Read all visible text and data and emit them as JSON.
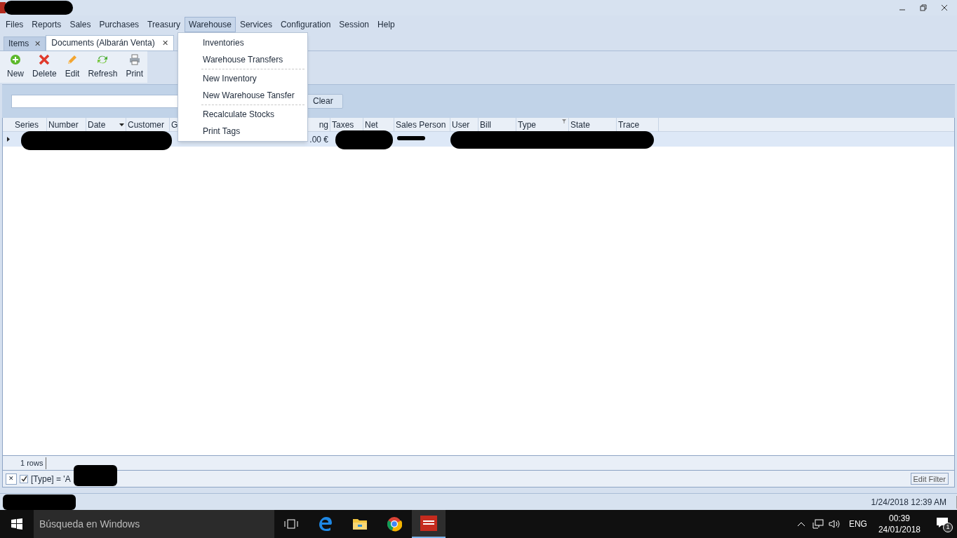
{
  "menu_bar": [
    {
      "label": "Files",
      "selected": false
    },
    {
      "label": "Reports",
      "selected": false
    },
    {
      "label": "Sales",
      "selected": false
    },
    {
      "label": "Purchases",
      "selected": false
    },
    {
      "label": "Treasury",
      "selected": false
    },
    {
      "label": "Warehouse",
      "selected": true
    },
    {
      "label": "Services",
      "selected": false
    },
    {
      "label": "Configuration",
      "selected": false
    },
    {
      "label": "Session",
      "selected": false
    },
    {
      "label": "Help",
      "selected": false
    }
  ],
  "dropdown_menu": [
    {
      "label": "Inventories",
      "separator_after": false
    },
    {
      "label": "Warehouse Transfers",
      "separator_after": true
    },
    {
      "label": "New Inventory",
      "separator_after": false
    },
    {
      "label": "New Warehouse Tansfer",
      "separator_after": true
    },
    {
      "label": "Recalculate Stocks",
      "separator_after": false
    },
    {
      "label": "Print Tags",
      "separator_after": false
    }
  ],
  "tabs": [
    {
      "label": "Items",
      "selected": false,
      "close": "✕"
    },
    {
      "label": "Documents (Albarán Venta)",
      "selected": true,
      "close": "✕"
    }
  ],
  "toolbar": [
    {
      "label": "New"
    },
    {
      "label": "Delete"
    },
    {
      "label": "Edit"
    },
    {
      "label": "Refresh"
    },
    {
      "label": "Print"
    }
  ],
  "search": {
    "button": "Clear"
  },
  "table": {
    "columns": [
      {
        "label": "Series"
      },
      {
        "label": "Number"
      },
      {
        "label": "Date",
        "sorted": true
      },
      {
        "label": "Customer"
      },
      {
        "label": "G"
      },
      {
        "label": "ng"
      },
      {
        "label": "Taxes"
      },
      {
        "label": "Net"
      },
      {
        "label": "Sales Person"
      },
      {
        "label": "User"
      },
      {
        "label": "Bill"
      },
      {
        "label": "Type",
        "filtered": true
      },
      {
        "label": "State"
      },
      {
        "label": "Trace"
      }
    ],
    "rows": [
      {
        "selected": true,
        "cells": [
          "",
          "",
          "",
          "",
          "",
          ".00 €",
          "",
          "",
          "",
          "",
          "",
          "",
          "",
          ""
        ]
      }
    ]
  },
  "footer": {
    "row_count": "1 rows"
  },
  "filter_bar": {
    "close": "✕",
    "enabled": true,
    "expression": "[Type] = 'A",
    "edit_button": "Edit Filter"
  },
  "status_bar": {
    "datetime": "1/24/2018 12:39 AM"
  },
  "taskbar": {
    "search_placeholder": "Búsqueda en Windows",
    "language": "ENG",
    "time": "00:39",
    "date": "24/01/2018",
    "notifications": "1"
  }
}
